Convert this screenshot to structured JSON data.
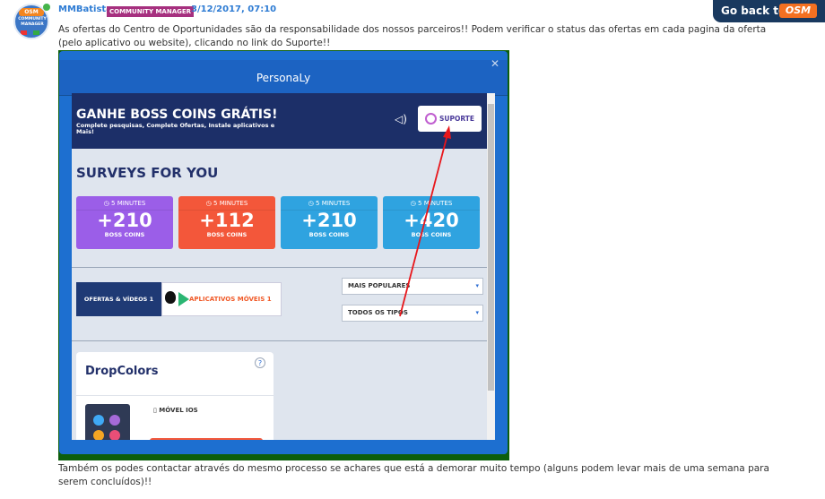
{
  "post": {
    "author": "MMBatista",
    "role": "COMMUNITY MANAGER",
    "date": "3/12/2017, 07:10",
    "avatar_badge_top": "OSM",
    "avatar_badge_text": "COMMUNITY MANAGER",
    "paragraph1": "As ofertas do Centro de Oportunidades são da responsabilidade dos nossos parceiros!! Podem verificar o status das ofertas em cada pagina da oferta (pelo aplicativo ou website), clicando no link do Suporte!!",
    "paragraph2": "Também os podes contactar através do mesmo processo se achares que está a demorar muito tempo (alguns podem levar mais de uma semana para serem concluídos)!!"
  },
  "go_back": {
    "label": "Go back to",
    "logo": "OSM"
  },
  "popup": {
    "title": "PersonaLy",
    "close": "✕",
    "banner_title": "GANHE BOSS COINS GRÁTIS!",
    "banner_subtitle": "Complete pesquisas, Complete Ofertas, Instale aplicativos e Mais!",
    "support_label": "SUPORTE",
    "surveys_title": "SURVEYS FOR YOU",
    "cards": [
      {
        "duration": "5 MINUTES",
        "points": "+210",
        "currency": "BOSS COINS",
        "color": "#9b5ee8"
      },
      {
        "duration": "5 MINUTES",
        "points": "+112",
        "currency": "BOSS COINS",
        "color": "#f3573a"
      },
      {
        "duration": "5 MINUTES",
        "points": "+210",
        "currency": "BOSS COINS",
        "color": "#2fa3e0"
      },
      {
        "duration": "5 MINUTES",
        "points": "+420",
        "currency": "BOSS COINS",
        "color": "#2fa3e0"
      }
    ],
    "tab_offers": "OFERTAS & VÍDEOS",
    "tab_offers_count": "1",
    "tab_apps": "APLICATIVOS MÓVEIS",
    "tab_apps_count": "1",
    "select_sort": "MAIS POPULARES",
    "select_type": "TODOS OS TIPOS",
    "offer_title": "DropColors",
    "offer_help": "?",
    "offer_platform": "MÓVEL",
    "offer_os": "IOS"
  },
  "colors": {
    "brand_blue": "#1d6fd0",
    "osm_orange": "#f37021",
    "annotation_red": "#e8161b"
  }
}
